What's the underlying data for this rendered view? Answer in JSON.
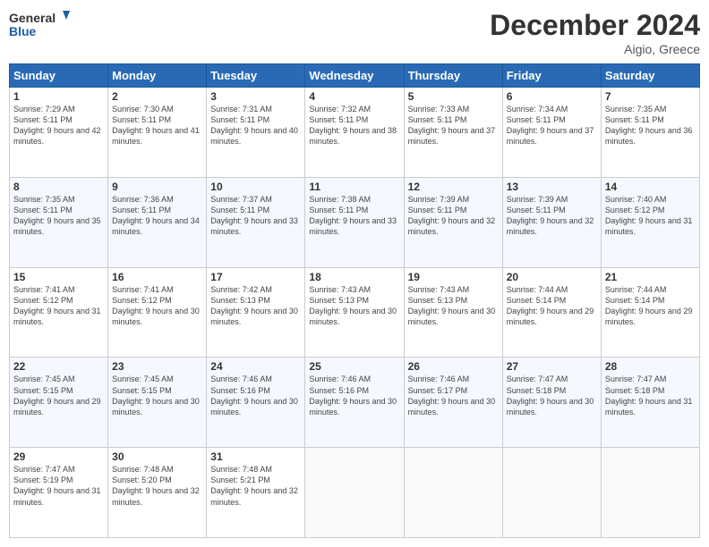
{
  "header": {
    "logo_line1": "General",
    "logo_line2": "Blue",
    "title": "December 2024",
    "location": "Aigio, Greece"
  },
  "days_header": [
    "Sunday",
    "Monday",
    "Tuesday",
    "Wednesday",
    "Thursday",
    "Friday",
    "Saturday"
  ],
  "weeks": [
    [
      {
        "day": "1",
        "sunrise": "Sunrise: 7:29 AM",
        "sunset": "Sunset: 5:11 PM",
        "daylight": "Daylight: 9 hours and 42 minutes."
      },
      {
        "day": "2",
        "sunrise": "Sunrise: 7:30 AM",
        "sunset": "Sunset: 5:11 PM",
        "daylight": "Daylight: 9 hours and 41 minutes."
      },
      {
        "day": "3",
        "sunrise": "Sunrise: 7:31 AM",
        "sunset": "Sunset: 5:11 PM",
        "daylight": "Daylight: 9 hours and 40 minutes."
      },
      {
        "day": "4",
        "sunrise": "Sunrise: 7:32 AM",
        "sunset": "Sunset: 5:11 PM",
        "daylight": "Daylight: 9 hours and 38 minutes."
      },
      {
        "day": "5",
        "sunrise": "Sunrise: 7:33 AM",
        "sunset": "Sunset: 5:11 PM",
        "daylight": "Daylight: 9 hours and 37 minutes."
      },
      {
        "day": "6",
        "sunrise": "Sunrise: 7:34 AM",
        "sunset": "Sunset: 5:11 PM",
        "daylight": "Daylight: 9 hours and 37 minutes."
      },
      {
        "day": "7",
        "sunrise": "Sunrise: 7:35 AM",
        "sunset": "Sunset: 5:11 PM",
        "daylight": "Daylight: 9 hours and 36 minutes."
      }
    ],
    [
      {
        "day": "8",
        "sunrise": "Sunrise: 7:35 AM",
        "sunset": "Sunset: 5:11 PM",
        "daylight": "Daylight: 9 hours and 35 minutes."
      },
      {
        "day": "9",
        "sunrise": "Sunrise: 7:36 AM",
        "sunset": "Sunset: 5:11 PM",
        "daylight": "Daylight: 9 hours and 34 minutes."
      },
      {
        "day": "10",
        "sunrise": "Sunrise: 7:37 AM",
        "sunset": "Sunset: 5:11 PM",
        "daylight": "Daylight: 9 hours and 33 minutes."
      },
      {
        "day": "11",
        "sunrise": "Sunrise: 7:38 AM",
        "sunset": "Sunset: 5:11 PM",
        "daylight": "Daylight: 9 hours and 33 minutes."
      },
      {
        "day": "12",
        "sunrise": "Sunrise: 7:39 AM",
        "sunset": "Sunset: 5:11 PM",
        "daylight": "Daylight: 9 hours and 32 minutes."
      },
      {
        "day": "13",
        "sunrise": "Sunrise: 7:39 AM",
        "sunset": "Sunset: 5:11 PM",
        "daylight": "Daylight: 9 hours and 32 minutes."
      },
      {
        "day": "14",
        "sunrise": "Sunrise: 7:40 AM",
        "sunset": "Sunset: 5:12 PM",
        "daylight": "Daylight: 9 hours and 31 minutes."
      }
    ],
    [
      {
        "day": "15",
        "sunrise": "Sunrise: 7:41 AM",
        "sunset": "Sunset: 5:12 PM",
        "daylight": "Daylight: 9 hours and 31 minutes."
      },
      {
        "day": "16",
        "sunrise": "Sunrise: 7:41 AM",
        "sunset": "Sunset: 5:12 PM",
        "daylight": "Daylight: 9 hours and 30 minutes."
      },
      {
        "day": "17",
        "sunrise": "Sunrise: 7:42 AM",
        "sunset": "Sunset: 5:13 PM",
        "daylight": "Daylight: 9 hours and 30 minutes."
      },
      {
        "day": "18",
        "sunrise": "Sunrise: 7:43 AM",
        "sunset": "Sunset: 5:13 PM",
        "daylight": "Daylight: 9 hours and 30 minutes."
      },
      {
        "day": "19",
        "sunrise": "Sunrise: 7:43 AM",
        "sunset": "Sunset: 5:13 PM",
        "daylight": "Daylight: 9 hours and 30 minutes."
      },
      {
        "day": "20",
        "sunrise": "Sunrise: 7:44 AM",
        "sunset": "Sunset: 5:14 PM",
        "daylight": "Daylight: 9 hours and 29 minutes."
      },
      {
        "day": "21",
        "sunrise": "Sunrise: 7:44 AM",
        "sunset": "Sunset: 5:14 PM",
        "daylight": "Daylight: 9 hours and 29 minutes."
      }
    ],
    [
      {
        "day": "22",
        "sunrise": "Sunrise: 7:45 AM",
        "sunset": "Sunset: 5:15 PM",
        "daylight": "Daylight: 9 hours and 29 minutes."
      },
      {
        "day": "23",
        "sunrise": "Sunrise: 7:45 AM",
        "sunset": "Sunset: 5:15 PM",
        "daylight": "Daylight: 9 hours and 30 minutes."
      },
      {
        "day": "24",
        "sunrise": "Sunrise: 7:46 AM",
        "sunset": "Sunset: 5:16 PM",
        "daylight": "Daylight: 9 hours and 30 minutes."
      },
      {
        "day": "25",
        "sunrise": "Sunrise: 7:46 AM",
        "sunset": "Sunset: 5:16 PM",
        "daylight": "Daylight: 9 hours and 30 minutes."
      },
      {
        "day": "26",
        "sunrise": "Sunrise: 7:46 AM",
        "sunset": "Sunset: 5:17 PM",
        "daylight": "Daylight: 9 hours and 30 minutes."
      },
      {
        "day": "27",
        "sunrise": "Sunrise: 7:47 AM",
        "sunset": "Sunset: 5:18 PM",
        "daylight": "Daylight: 9 hours and 30 minutes."
      },
      {
        "day": "28",
        "sunrise": "Sunrise: 7:47 AM",
        "sunset": "Sunset: 5:18 PM",
        "daylight": "Daylight: 9 hours and 31 minutes."
      }
    ],
    [
      {
        "day": "29",
        "sunrise": "Sunrise: 7:47 AM",
        "sunset": "Sunset: 5:19 PM",
        "daylight": "Daylight: 9 hours and 31 minutes."
      },
      {
        "day": "30",
        "sunrise": "Sunrise: 7:48 AM",
        "sunset": "Sunset: 5:20 PM",
        "daylight": "Daylight: 9 hours and 32 minutes."
      },
      {
        "day": "31",
        "sunrise": "Sunrise: 7:48 AM",
        "sunset": "Sunset: 5:21 PM",
        "daylight": "Daylight: 9 hours and 32 minutes."
      },
      null,
      null,
      null,
      null
    ]
  ]
}
